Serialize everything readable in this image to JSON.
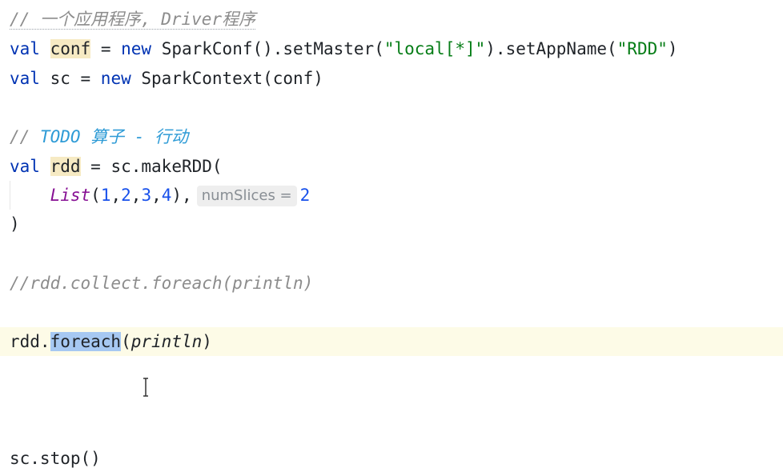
{
  "code": {
    "line1": {
      "comment": "// 一个应用程序, Driver程序"
    },
    "line2": {
      "kw_val": "val",
      "sp1": " ",
      "var": "conf",
      "eq": " = ",
      "kw_new": "new",
      "call": " SparkConf().setMaster(",
      "str1": "\"local[*]\"",
      "mid": ").setAppName(",
      "str2": "\"RDD\"",
      "end": ")"
    },
    "line3": {
      "kw_val": "val",
      "mid": " sc = ",
      "kw_new": "new",
      "rest": " SparkContext(conf)"
    },
    "line5": {
      "slashes": "// ",
      "todo": "TODO 算子 - 行动"
    },
    "line6": {
      "kw_val": "val",
      "sp1": " ",
      "var": "rdd",
      "rest": " = sc.makeRDD("
    },
    "line7": {
      "indent": "    ",
      "fn": "List",
      "open": "(",
      "n1": "1",
      "c1": ",",
      "n2": "2",
      "c2": ",",
      "n3": "3",
      "c3": ",",
      "n4": "4",
      "close": "),",
      "hint": "numSlices =",
      "n5": "2"
    },
    "line8": {
      "text": ")"
    },
    "line10": {
      "comment": "//rdd.collect.foreach(println)"
    },
    "line12": {
      "obj": "rdd.",
      "method": "foreach",
      "open": "(",
      "arg": "println",
      "close": ")"
    },
    "line16": {
      "text": "sc.stop()"
    }
  },
  "icons": {
    "cursor": "text-cursor-icon"
  }
}
